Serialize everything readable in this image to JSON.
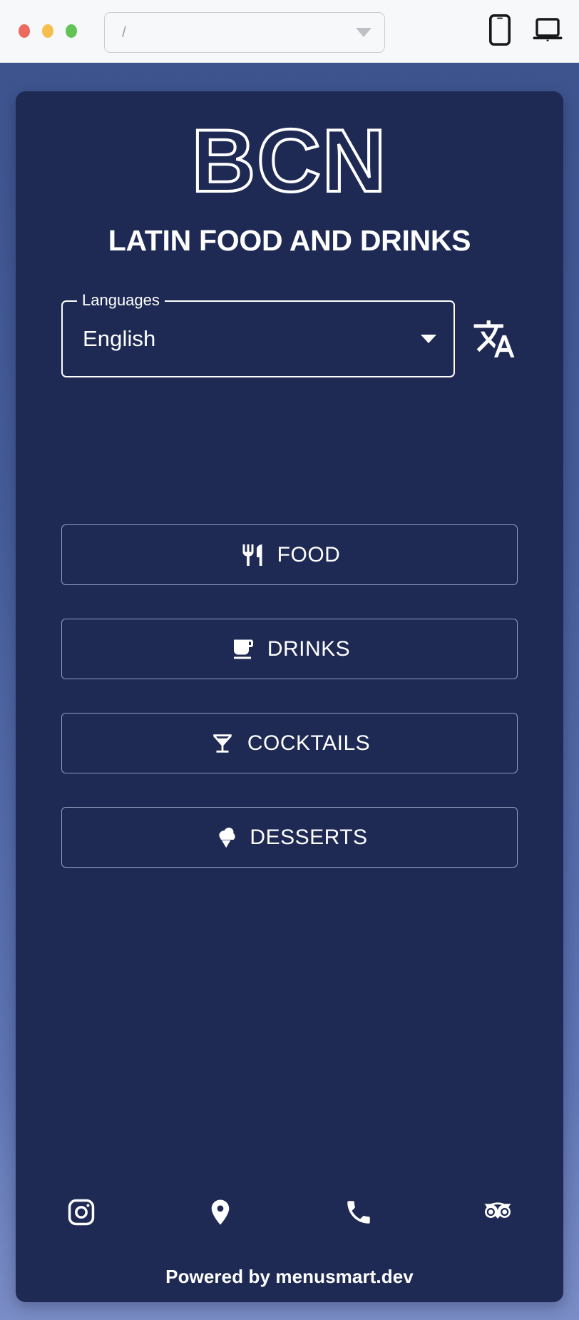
{
  "browser_chrome": {
    "url_value": "/",
    "url_placeholder": "/",
    "traffic_lights": [
      "close",
      "minimize",
      "maximize"
    ],
    "device_buttons": [
      {
        "name": "mobile-view",
        "icon": "phone-icon"
      },
      {
        "name": "desktop-view",
        "icon": "laptop-icon"
      }
    ]
  },
  "theme": {
    "page_background_top": "#3e548f",
    "page_background_bottom": "#7b8dc6",
    "card_background": "#1e2a54",
    "text_color": "#ffffff",
    "button_border": "#8f9bbd"
  },
  "brand": {
    "logo_text": "BCN",
    "tagline": "LATIN FOOD AND DRINKS"
  },
  "language_selector": {
    "label": "Languages",
    "selected": "English",
    "options": [
      "English"
    ],
    "caret_icon": "chevron-down-icon",
    "translate_icon": "translate-icon"
  },
  "categories": [
    {
      "label": "FOOD",
      "icon": "restaurant-icon"
    },
    {
      "label": "DRINKS",
      "icon": "coffee-cup-icon"
    },
    {
      "label": "COCKTAILS",
      "icon": "martini-glass-icon"
    },
    {
      "label": "DESSERTS",
      "icon": "ice-cream-icon"
    }
  ],
  "social_links": [
    {
      "name": "instagram",
      "icon": "instagram-icon"
    },
    {
      "name": "location",
      "icon": "map-pin-icon"
    },
    {
      "name": "phone",
      "icon": "phone-call-icon"
    },
    {
      "name": "tripadvisor",
      "icon": "tripadvisor-owl-icon"
    }
  ],
  "footer": {
    "powered_by": "Powered by menusmart.dev"
  }
}
